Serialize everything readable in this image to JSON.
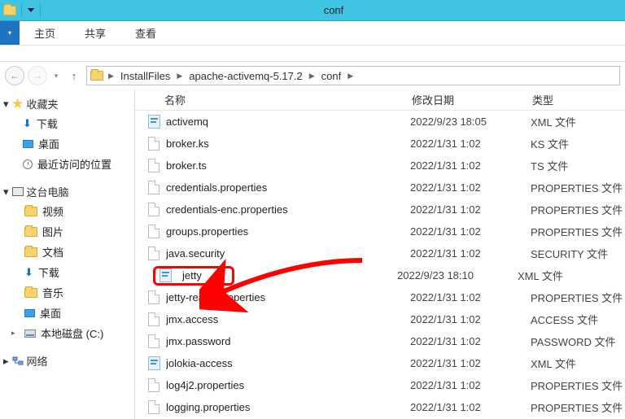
{
  "window": {
    "title": "conf"
  },
  "ribbon": {
    "tabs": [
      "主页",
      "共享",
      "查看"
    ]
  },
  "breadcrumb": {
    "items": [
      "InstallFiles",
      "apache-activemq-5.17.2",
      "conf"
    ]
  },
  "sidebar": {
    "favorites_label": "收藏夹",
    "favorites": [
      {
        "label": "下载",
        "icon": "download"
      },
      {
        "label": "桌面",
        "icon": "desktop"
      },
      {
        "label": "最近访问的位置",
        "icon": "recent"
      }
    ],
    "thispc_label": "这台电脑",
    "thispc": [
      {
        "label": "视频",
        "icon": "video"
      },
      {
        "label": "图片",
        "icon": "picture"
      },
      {
        "label": "文档",
        "icon": "document"
      },
      {
        "label": "下载",
        "icon": "download"
      },
      {
        "label": "音乐",
        "icon": "music"
      },
      {
        "label": "桌面",
        "icon": "desktop"
      },
      {
        "label": "本地磁盘 (C:)",
        "icon": "hdd",
        "expandable": true
      }
    ],
    "network_label": "网络"
  },
  "columns": {
    "name": "名称",
    "date": "修改日期",
    "type": "类型"
  },
  "files": [
    {
      "name": "activemq",
      "date": "2022/9/23 18:05",
      "type": "XML 文件",
      "icon": "xml"
    },
    {
      "name": "broker.ks",
      "date": "2022/1/31 1:02",
      "type": "KS 文件",
      "icon": "blank"
    },
    {
      "name": "broker.ts",
      "date": "2022/1/31 1:02",
      "type": "TS 文件",
      "icon": "blank"
    },
    {
      "name": "credentials.properties",
      "date": "2022/1/31 1:02",
      "type": "PROPERTIES 文件",
      "icon": "blank"
    },
    {
      "name": "credentials-enc.properties",
      "date": "2022/1/31 1:02",
      "type": "PROPERTIES 文件",
      "icon": "blank"
    },
    {
      "name": "groups.properties",
      "date": "2022/1/31 1:02",
      "type": "PROPERTIES 文件",
      "icon": "blank"
    },
    {
      "name": "java.security",
      "date": "2022/1/31 1:02",
      "type": "SECURITY 文件",
      "icon": "blank"
    },
    {
      "name": "jetty",
      "date": "2022/9/23 18:10",
      "type": "XML 文件",
      "icon": "xml",
      "highlighted": true
    },
    {
      "name": "jetty-realm.properties",
      "date": "2022/1/31 1:02",
      "type": "PROPERTIES 文件",
      "icon": "blank"
    },
    {
      "name": "jmx.access",
      "date": "2022/1/31 1:02",
      "type": "ACCESS 文件",
      "icon": "blank"
    },
    {
      "name": "jmx.password",
      "date": "2022/1/31 1:02",
      "type": "PASSWORD 文件",
      "icon": "blank"
    },
    {
      "name": "jolokia-access",
      "date": "2022/1/31 1:02",
      "type": "XML 文件",
      "icon": "xml"
    },
    {
      "name": "log4j2.properties",
      "date": "2022/1/31 1:02",
      "type": "PROPERTIES 文件",
      "icon": "blank"
    },
    {
      "name": "logging.properties",
      "date": "2022/1/31 1:02",
      "type": "PROPERTIES 文件",
      "icon": "blank"
    }
  ],
  "annotation": {
    "target_file": "jetty"
  }
}
